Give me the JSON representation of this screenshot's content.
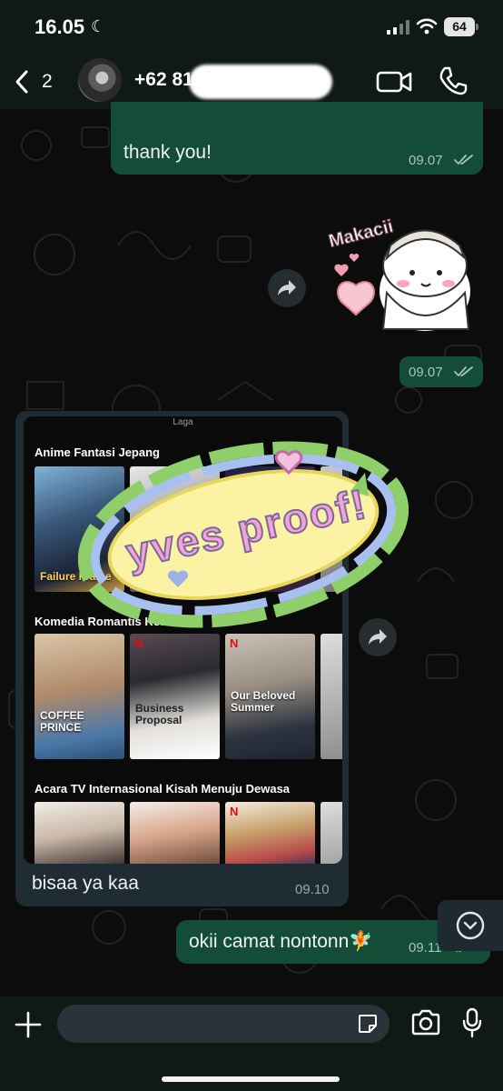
{
  "status_bar": {
    "time": "16.05",
    "battery": "64",
    "moon_icon": "moon-icon",
    "signal_icon": "cellular-signal-icon",
    "wifi_icon": "wifi-icon"
  },
  "header": {
    "back_count": "2",
    "contact_name": "+62 81",
    "back_icon": "chevron-left-icon",
    "video_icon": "video-camera-icon",
    "call_icon": "phone-icon"
  },
  "messages": [
    {
      "direction": "outgoing",
      "text": "thank you!",
      "time": "09.07",
      "status": "read"
    },
    {
      "direction": "outgoing",
      "type": "sticker",
      "sticker_text": "Makacii",
      "time": "09.07",
      "status": "read"
    },
    {
      "direction": "incoming",
      "type": "image",
      "caption": "bisaa ya kaa",
      "time": "09.10"
    },
    {
      "direction": "outgoing",
      "text": "okii camat nontonn🧚",
      "time": "09.11",
      "status": "read"
    }
  ],
  "shared_image": {
    "header": "Laga",
    "rows": [
      {
        "title": "Anime Fantasi Jepang",
        "posters": [
          "Failure Frame",
          "",
          "",
          ""
        ]
      },
      {
        "title": "Komedia Romantis Korea",
        "posters": [
          "COFFEE PRINCE",
          "Business Proposal",
          "Our Beloved Summer",
          ""
        ]
      },
      {
        "title": "Acara TV Internasional Kisah Menuju Dewasa",
        "posters": [
          "",
          "",
          "",
          ""
        ]
      }
    ],
    "watermark": "yves proof!"
  },
  "input": {
    "placeholder": "",
    "plus_icon": "plus-icon",
    "sticker_icon": "sticker-icon",
    "camera_icon": "camera-icon",
    "mic_icon": "microphone-icon"
  },
  "colors": {
    "outgoing_bubble": "#144d37",
    "incoming_bubble": "#1f2c33",
    "header_bg": "#0f1a14",
    "background": "#0c0c0c"
  }
}
